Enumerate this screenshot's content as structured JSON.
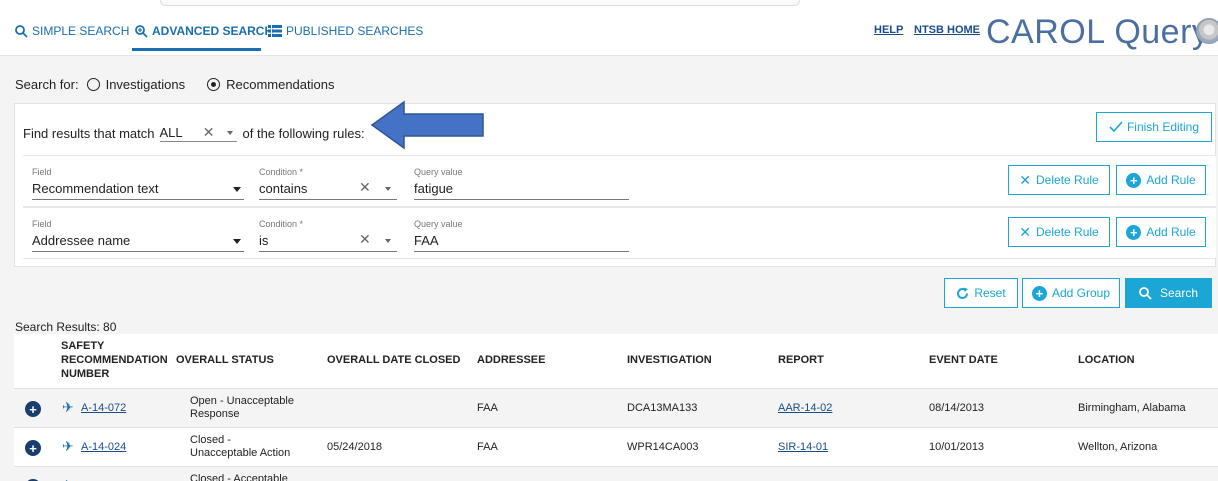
{
  "nav": {
    "tabs": [
      {
        "label": "SIMPLE SEARCH"
      },
      {
        "label": "ADVANCED SEARCH"
      },
      {
        "label": "PUBLISHED SEARCHES"
      }
    ],
    "links": [
      {
        "label": "HELP"
      },
      {
        "label": "NTSB HOME"
      }
    ],
    "brand": "CAROL Query"
  },
  "search_for": {
    "label": "Search for:",
    "options": [
      {
        "label": "Investigations",
        "selected": false
      },
      {
        "label": "Recommendations",
        "selected": true
      }
    ]
  },
  "rules_panel": {
    "prefix": "Find results that match",
    "match": "ALL",
    "suffix": "of the following rules:",
    "finish_label": "Finish Editing",
    "rules": [
      {
        "field_label": "Field",
        "field": "Recommendation text",
        "condition_label": "Condition *",
        "condition": "contains",
        "query_label": "Query value",
        "query": "fatigue",
        "delete_label": "Delete Rule",
        "add_label": "Add Rule"
      },
      {
        "field_label": "Field",
        "field": "Addressee name",
        "condition_label": "Condition *",
        "condition": "is",
        "query_label": "Query value",
        "query": "FAA",
        "delete_label": "Delete Rule",
        "add_label": "Add Rule"
      }
    ]
  },
  "actions": {
    "reset": "Reset",
    "add_group": "Add Group",
    "search": "Search"
  },
  "results": {
    "title": "Search Results: 80",
    "columns": [
      "SAFETY RECOMMENDATION NUMBER",
      "OVERALL STATUS",
      "OVERALL DATE CLOSED",
      "ADDRESSEE",
      "INVESTIGATION",
      "REPORT",
      "EVENT DATE",
      "LOCATION"
    ],
    "rows": [
      {
        "number": "A-14-072",
        "status": "Open - Unacceptable Response",
        "date_closed": "",
        "addressee": "FAA",
        "investigation": "DCA13MA133",
        "report": "AAR-14-02",
        "event_date": "08/14/2013",
        "location": "Birmingham, Alabama"
      },
      {
        "number": "A-14-024",
        "status": "Closed - Unacceptable Action",
        "date_closed": "05/24/2018",
        "addressee": "FAA",
        "investigation": "WPR14CA003",
        "report": "SIR-14-01",
        "event_date": "10/01/2013",
        "location": "Wellton, Arizona"
      },
      {
        "number": "",
        "status": "Closed - Acceptable",
        "date_closed": "",
        "addressee": "",
        "investigation": "",
        "report": "",
        "event_date": "",
        "location": ""
      }
    ]
  },
  "colors": {
    "accent": "#1ba6d6",
    "nav_blue": "#1a6fb0",
    "arrow_fill": "#4472c4"
  }
}
